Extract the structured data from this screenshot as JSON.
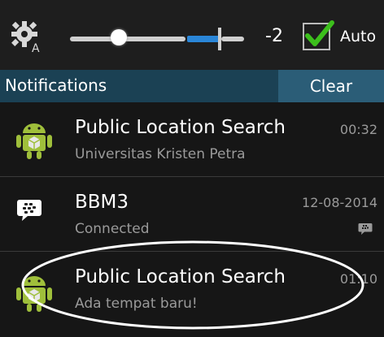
{
  "quick_settings": {
    "gear_icon": "gear-auto-brightness-icon",
    "brightness_value": "-2",
    "brightness_level": 0.3,
    "auto_label": "Auto",
    "auto_checked": true
  },
  "notifications": {
    "title": "Notifications",
    "clear_label": "Clear",
    "items": [
      {
        "icon": "android-icon",
        "title": "Public Location Search",
        "subtitle": "Universitas Kristen Petra",
        "time": "00:32"
      },
      {
        "icon": "bbm-icon",
        "title": "BBM3",
        "subtitle": "Connected",
        "time": "12-08-2014",
        "small_icon": "bbm-small-icon"
      },
      {
        "icon": "android-icon",
        "title": "Public Location Search",
        "subtitle": "Ada tempat baru!",
        "time": "01:10"
      }
    ]
  },
  "colors": {
    "header_bg": "#1b4154",
    "clear_bg": "#2b5d77",
    "slider_accent": "#2a86d8",
    "check_green": "#3cbf1c",
    "android_green": "#9fbf3b"
  }
}
